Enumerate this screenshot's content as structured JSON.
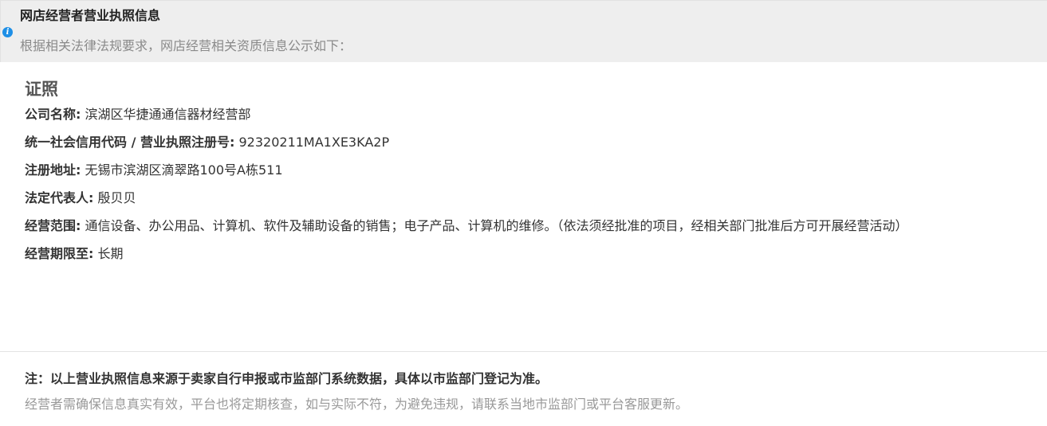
{
  "banner": {
    "icon": "info-icon",
    "icon_glyph": "i",
    "title": "网店经营者营业执照信息",
    "description": "根据相关法律法规要求，网店经营相关资质信息公示如下："
  },
  "section": {
    "heading": "证照",
    "rows": [
      {
        "label": "公司名称:",
        "value": "滨湖区华捷通通信器材经营部"
      },
      {
        "label": "统一社会信用代码 / 营业执照注册号:",
        "value": "92320211MA1XE3KA2P"
      },
      {
        "label": "注册地址:",
        "value": "无锡市滨湖区滴翠路100号A栋511"
      },
      {
        "label": "法定代表人:",
        "value": "殷贝贝"
      },
      {
        "label": "经营范围:",
        "value": "通信设备、办公用品、计算机、软件及辅助设备的销售；电子产品、计算机的维修。（依法须经批准的项目，经相关部门批准后方可开展经营活动）"
      },
      {
        "label": "经营期限至:",
        "value": "长期"
      }
    ]
  },
  "footer": {
    "note": "注：以上营业执照信息来源于卖家自行申报或市监部门系统数据，具体以市监部门登记为准。",
    "description": "经营者需确保信息真实有效，平台也将定期核查，如与实际不符，为避免违规，请联系当地市监部门或平台客服更新。"
  },
  "colors": {
    "banner_background": "#eeeeee",
    "info_icon": "#1e8fe6",
    "muted_text": "#999999"
  }
}
